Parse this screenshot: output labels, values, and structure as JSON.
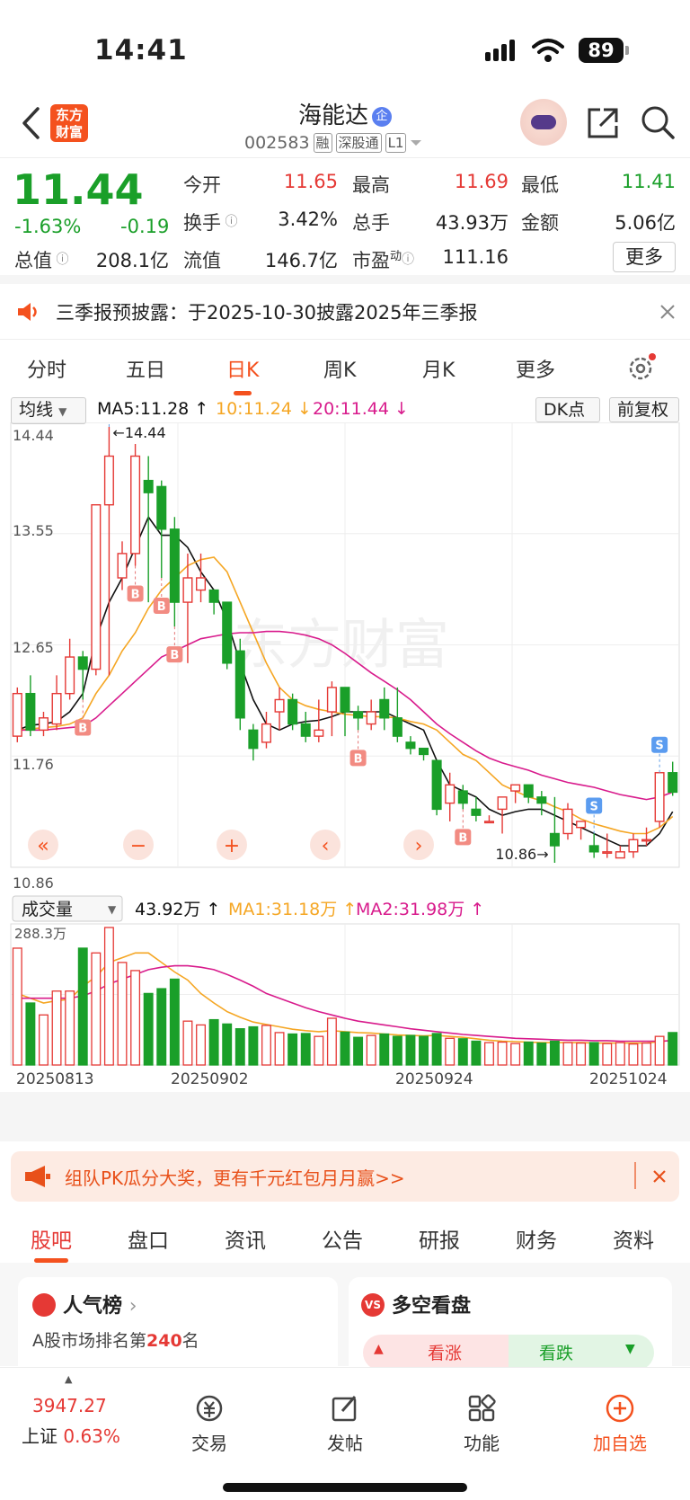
{
  "status_bar": {
    "time": "14:41",
    "battery": "89"
  },
  "header": {
    "logo": "东方财富",
    "stock_name": "海能达",
    "name_badge": "企",
    "stock_code": "002583",
    "tags": [
      "融",
      "深股通",
      "L1"
    ]
  },
  "quote": {
    "price": "11.44",
    "change_pct": "-1.63%",
    "change_amt": "-0.19",
    "fields": [
      {
        "label": "今开",
        "value": "11.65",
        "color": "#e53935"
      },
      {
        "label": "最高",
        "value": "11.69",
        "color": "#e53935"
      },
      {
        "label": "最低",
        "value": "11.41",
        "color": "#1a9f29"
      },
      {
        "label": "换手",
        "value": "3.42%",
        "color": "#333333"
      },
      {
        "label": "总手",
        "value": "43.93万",
        "color": "#333333"
      },
      {
        "label": "金额",
        "value": "5.06亿",
        "color": "#333333"
      },
      {
        "label": "总值",
        "value": "208.1亿",
        "color": "#333333"
      },
      {
        "label": "流值",
        "value": "146.7亿",
        "color": "#333333"
      },
      {
        "label": "市盈",
        "value": "111.16",
        "color": "#333333"
      }
    ],
    "pe_superscript": "动",
    "more_button": "更多"
  },
  "notice": {
    "text": "三季报预披露：于2025-10-30披露2025年三季报"
  },
  "kline_tabs": [
    "分时",
    "五日",
    "日K",
    "周K",
    "月K",
    "更多"
  ],
  "active_tab": "日K",
  "ma_bar": {
    "selector": "均线",
    "ma5": "MA5:11.28",
    "ma10": "10:11.24",
    "ma20": "20:11.44",
    "dk": "DK点",
    "fq": "前复权"
  },
  "vol_bar": {
    "selector": "成交量",
    "vol": "43.92万",
    "ma1": "MA1:31.18万",
    "ma2": "MA2:31.98万"
  },
  "colors": {
    "up": "#e53935",
    "down": "#1a9f29",
    "ma5": "#111111",
    "ma10": "#f5a623",
    "ma20": "#d81b8c",
    "accent": "#f4511e"
  },
  "chart_data": {
    "type": "candlestick",
    "price_axis_ticks": [
      "14.44",
      "13.55",
      "12.65",
      "11.76",
      "10.86"
    ],
    "ylim": [
      10.86,
      14.44
    ],
    "high_marker": "14.44",
    "low_marker": "10.86",
    "volume_axis_max": "288.3万",
    "date_labels": [
      "20250813",
      "20250902",
      "20250924",
      "20251024"
    ],
    "candles": [
      [
        11.9,
        12.25,
        11.85,
        12.3
      ],
      [
        12.25,
        11.95,
        11.9,
        12.4
      ],
      [
        11.95,
        12.05,
        11.9,
        12.1
      ],
      [
        12.0,
        12.25,
        11.95,
        12.4
      ],
      [
        12.25,
        12.55,
        12.2,
        12.7
      ],
      [
        12.55,
        12.45,
        12.2,
        12.6
      ],
      [
        12.45,
        13.8,
        12.4,
        13.8
      ],
      [
        13.8,
        14.2,
        12.4,
        14.44
      ],
      [
        13.2,
        13.4,
        13.1,
        13.5
      ],
      [
        13.4,
        14.2,
        13.3,
        14.3
      ],
      [
        14.0,
        13.9,
        13.0,
        14.2
      ],
      [
        13.95,
        13.6,
        13.2,
        14.0
      ],
      [
        13.6,
        13.0,
        12.8,
        13.7
      ],
      [
        13.0,
        13.2,
        12.5,
        13.4
      ],
      [
        13.1,
        13.2,
        13.0,
        13.4
      ],
      [
        13.1,
        13.0,
        12.9,
        13.1
      ],
      [
        13.0,
        12.5,
        12.45,
        13.0
      ],
      [
        12.6,
        12.05,
        11.95,
        12.7
      ],
      [
        11.95,
        11.8,
        11.7,
        12.0
      ],
      [
        11.85,
        12.0,
        11.8,
        12.1
      ],
      [
        12.1,
        12.2,
        11.95,
        12.3
      ],
      [
        12.2,
        12.0,
        11.95,
        12.25
      ],
      [
        12.0,
        11.9,
        11.85,
        12.1
      ],
      [
        11.9,
        11.95,
        11.85,
        12.2
      ],
      [
        12.1,
        12.3,
        11.9,
        12.35
      ],
      [
        12.3,
        12.1,
        11.9,
        12.3
      ],
      [
        12.1,
        12.05,
        11.95,
        12.15
      ],
      [
        12.0,
        12.1,
        11.95,
        12.2
      ],
      [
        12.2,
        12.05,
        11.95,
        12.3
      ],
      [
        12.05,
        11.9,
        11.85,
        12.3
      ],
      [
        11.85,
        11.8,
        11.75,
        11.9
      ],
      [
        11.8,
        11.75,
        11.7,
        11.8
      ],
      [
        11.7,
        11.3,
        11.25,
        11.7
      ],
      [
        11.35,
        11.5,
        11.2,
        11.6
      ],
      [
        11.45,
        11.35,
        11.3,
        11.5
      ],
      [
        11.3,
        11.25,
        11.2,
        11.4
      ],
      [
        11.2,
        11.2,
        11.2,
        11.25
      ],
      [
        11.3,
        11.4,
        11.1,
        11.4
      ],
      [
        11.45,
        11.5,
        11.35,
        11.5
      ],
      [
        11.5,
        11.4,
        11.35,
        11.5
      ],
      [
        11.4,
        11.35,
        11.25,
        11.45
      ],
      [
        11.1,
        11.0,
        10.86,
        11.4
      ],
      [
        11.1,
        11.3,
        11.05,
        11.35
      ],
      [
        11.15,
        11.2,
        11.05,
        11.2
      ],
      [
        11.0,
        10.95,
        10.9,
        11.1
      ],
      [
        10.95,
        10.95,
        10.9,
        11.1
      ],
      [
        10.9,
        10.95,
        10.9,
        11.0
      ],
      [
        10.95,
        11.05,
        10.9,
        11.1
      ],
      [
        11.05,
        11.05,
        11.0,
        11.15
      ],
      [
        11.2,
        11.6,
        11.15,
        11.6
      ],
      [
        11.6,
        11.44,
        11.41,
        11.69
      ]
    ],
    "volumes": [
      245,
      130,
      105,
      155,
      155,
      245,
      235,
      288.3,
      215,
      198,
      150,
      160,
      180,
      92,
      84,
      95,
      86,
      76,
      80,
      83,
      68,
      65,
      66,
      60,
      98,
      69,
      58,
      62,
      65,
      60,
      62,
      60,
      66,
      56,
      55,
      50,
      47,
      48,
      45,
      48,
      46,
      50,
      47,
      46,
      47,
      45,
      47,
      44,
      46,
      60,
      68
    ],
    "series": [
      {
        "name": "MA5",
        "values": [
          11.95,
          11.99,
          12.0,
          12.02,
          12.1,
          12.25,
          12.7,
          13.0,
          13.2,
          13.45,
          13.7,
          13.55,
          13.55,
          13.45,
          13.25,
          13.1,
          12.85,
          12.5,
          12.2,
          12.0,
          11.95,
          12.0,
          12.02,
          12.03,
          12.06,
          12.1,
          12.1,
          12.1,
          12.1,
          12.05,
          12.0,
          11.95,
          11.7,
          11.5,
          11.45,
          11.4,
          11.3,
          11.25,
          11.28,
          11.3,
          11.3,
          11.25,
          11.2,
          11.15,
          11.1,
          11.05,
          11.0,
          11.0,
          11.0,
          11.1,
          11.28
        ]
      },
      {
        "name": "10",
        "values": [
          11.95,
          11.96,
          11.97,
          11.98,
          12.0,
          12.05,
          12.25,
          12.4,
          12.6,
          12.75,
          12.95,
          13.1,
          13.2,
          13.3,
          13.35,
          13.37,
          13.25,
          13.0,
          12.75,
          12.5,
          12.3,
          12.2,
          12.15,
          12.12,
          12.1,
          12.08,
          12.07,
          12.06,
          12.06,
          12.05,
          12.02,
          12.0,
          11.95,
          11.85,
          11.75,
          11.7,
          11.6,
          11.5,
          11.45,
          11.4,
          11.37,
          11.32,
          11.28,
          11.22,
          11.18,
          11.15,
          11.12,
          11.1,
          11.1,
          11.15,
          11.24
        ]
      },
      {
        "name": "20",
        "values": [
          11.95,
          11.95,
          11.95,
          11.96,
          11.97,
          11.98,
          12.05,
          12.15,
          12.25,
          12.35,
          12.45,
          12.55,
          12.6,
          12.65,
          12.7,
          12.72,
          12.74,
          12.75,
          12.75,
          12.76,
          12.76,
          12.75,
          12.73,
          12.7,
          12.65,
          12.58,
          12.5,
          12.42,
          12.35,
          12.28,
          12.2,
          12.1,
          12.0,
          11.92,
          11.85,
          11.78,
          11.72,
          11.68,
          11.65,
          11.62,
          11.58,
          11.55,
          11.52,
          11.5,
          11.48,
          11.45,
          11.42,
          11.4,
          11.38,
          11.4,
          11.44
        ]
      }
    ],
    "vol_series": [
      {
        "name": "MA1",
        "values": [
          150,
          140,
          130,
          135,
          138,
          165,
          185,
          215,
          225,
          235,
          235,
          215,
          195,
          178,
          150,
          130,
          112,
          100,
          90,
          85,
          80,
          75,
          72,
          70,
          72,
          70,
          68,
          67,
          65,
          63,
          62,
          61,
          62,
          60,
          58,
          55,
          52,
          50,
          49,
          48,
          47,
          47,
          47,
          47,
          46,
          46,
          46,
          46,
          46,
          49,
          52
        ]
      },
      {
        "name": "MA2",
        "values": [
          140,
          140,
          140,
          140,
          140,
          145,
          155,
          170,
          180,
          190,
          200,
          205,
          208,
          208,
          205,
          200,
          190,
          178,
          165,
          150,
          140,
          130,
          120,
          112,
          105,
          98,
          92,
          88,
          84,
          80,
          76,
          73,
          70,
          67,
          64,
          62,
          60,
          58,
          56,
          55,
          54,
          53,
          52,
          52,
          51,
          51,
          50,
          50,
          50,
          50,
          51
        ]
      }
    ],
    "markers": [
      {
        "label": "B",
        "index": 5
      },
      {
        "label": "S",
        "index": 7
      },
      {
        "label": "B",
        "index": 9
      },
      {
        "label": "B",
        "index": 11
      },
      {
        "label": "B",
        "index": 12
      },
      {
        "label": "B",
        "index": 26
      },
      {
        "label": "B",
        "index": 34
      },
      {
        "label": "S",
        "index": 44
      },
      {
        "label": "S",
        "index": 49
      }
    ]
  },
  "chart_controls": [
    "«",
    "−",
    "+",
    "‹",
    "›"
  ],
  "banner": {
    "text": "组队PK瓜分大奖，更有千元红包月月赢>>"
  },
  "sub_tabs": [
    "股吧",
    "盘口",
    "资讯",
    "公告",
    "研报",
    "财务",
    "资料"
  ],
  "active_sub_tab": "股吧",
  "cards": {
    "left_title": "人气榜",
    "left_rank_prefix": "A股市场排名第",
    "left_rank": "240",
    "left_rank_suffix": "名",
    "right_title": "多空看盘",
    "bull": "看涨",
    "bear": "看跌"
  },
  "bottom_nav": {
    "index_value": "3947.27",
    "index_name": "上证",
    "index_change": "0.63%",
    "items": [
      "交易",
      "发帖",
      "功能",
      "加自选"
    ]
  }
}
